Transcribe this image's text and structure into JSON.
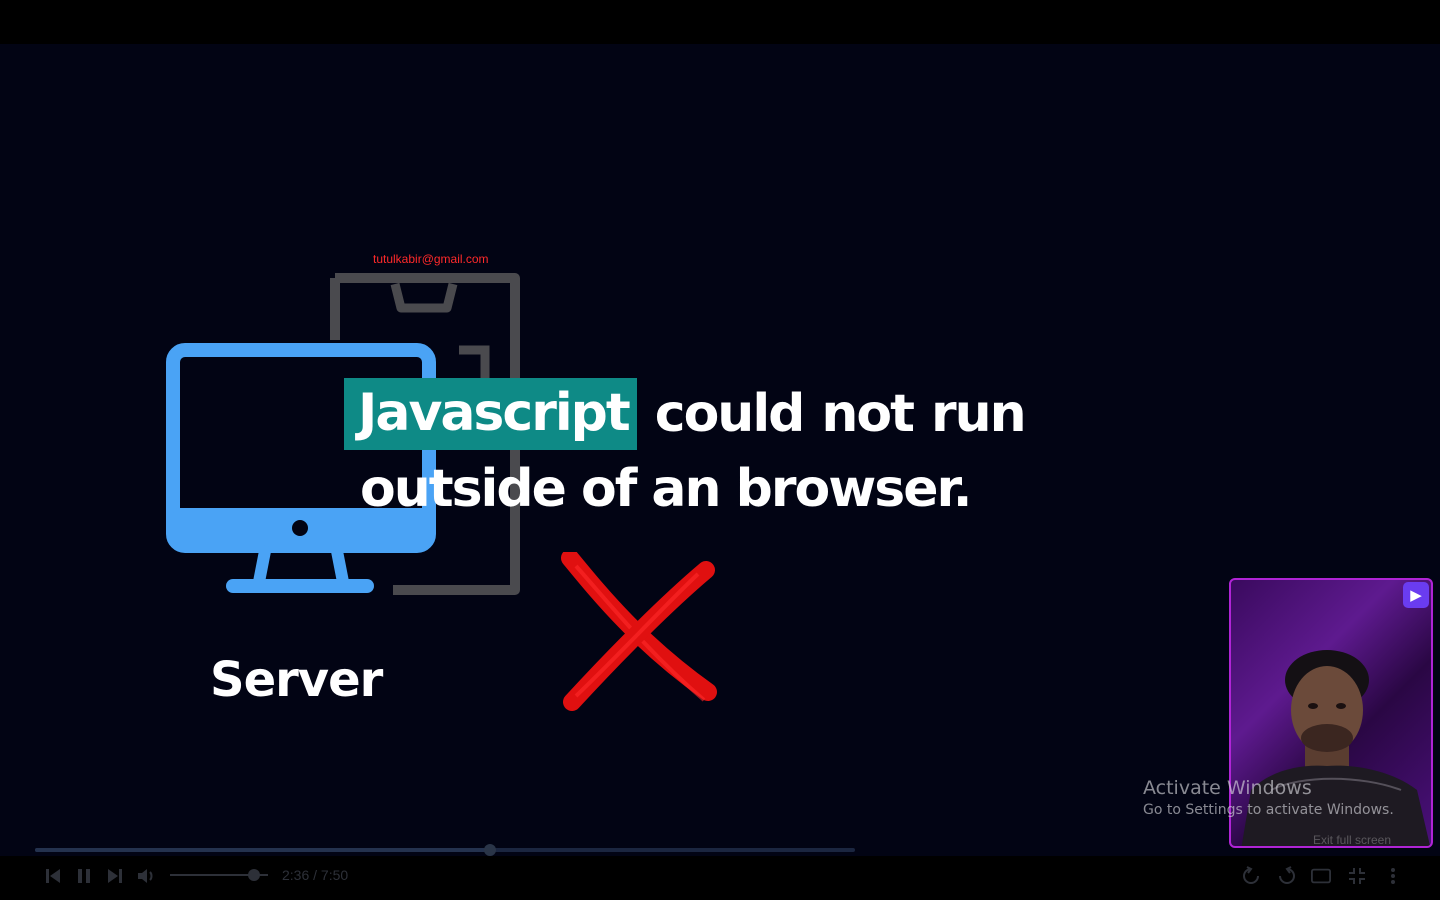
{
  "player": {
    "watermark_email": "tutulkabir@gmail.com",
    "time_display": "2:36 / 7:50",
    "progress_fraction": 0.555,
    "volume_fraction": 0.86,
    "exit_fullscreen_label": "Exit full screen"
  },
  "slide": {
    "caption_highlight": "Javascript",
    "caption_words": [
      "could",
      "not",
      "run"
    ],
    "caption_line2": "outside of an browser.",
    "server_label": "Server",
    "colors": {
      "highlight_bg": "#0e8a86",
      "monitor": "#4aa3f5",
      "phone": "#4a4a4e",
      "cross": "#e01010"
    }
  },
  "webcam": {
    "badge_icon": "play-flag-icon",
    "border_color": "#b024d6"
  },
  "os_overlay": {
    "activate_title": "Activate Windows",
    "activate_subtitle": "Go to Settings to activate Windows."
  },
  "controls": {
    "icons": [
      "previous-icon",
      "pause-icon",
      "next-icon",
      "volume-icon",
      "replay-icon",
      "forward-icon",
      "theater-icon",
      "fullscreen-exit-icon",
      "more-icon"
    ]
  }
}
